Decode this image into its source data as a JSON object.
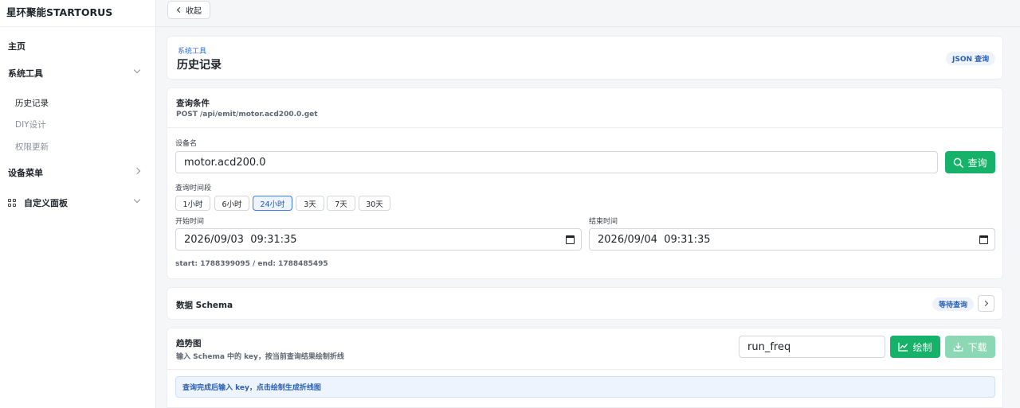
{
  "sidebar": {
    "brand": "星环聚能STARTORUS",
    "home": "主页",
    "system_tools": "系统工具",
    "history": "历史记录",
    "diy": "DIY设计",
    "permission": "权限更新",
    "device_menu": "设备菜单",
    "custom_panel": "自定义面板"
  },
  "topbar": {
    "collapse_label": "收起"
  },
  "header": {
    "breadcrumb": "系统工具",
    "title": "历史记录",
    "json_query": "JSON 查询"
  },
  "query": {
    "title": "查询条件",
    "endpoint": "POST /api/emit/motor.acd200.0.get",
    "device_label": "设备名",
    "device_value": "motor.acd200.0",
    "query_button": "查询",
    "range_label": "查询时间段",
    "ranges": [
      "1小时",
      "6小时",
      "24小时",
      "3天",
      "7天",
      "30天"
    ],
    "selected_range": "24小时",
    "start_label": "开始时间",
    "start_value": "2026/09/03  09:31:35",
    "end_label": "结束时间",
    "end_value": "2026/09/04  09:31:35",
    "epoch_summary": "start: 1788399095 / end: 1788485495"
  },
  "schema": {
    "title": "数据 Schema",
    "status": "等待查询"
  },
  "trend": {
    "title": "趋势图",
    "subtitle": "输入 Schema 中的 key，按当前查询结果绘制折线",
    "key_value": "run_freq",
    "draw_button": "绘制",
    "download_button": "下载",
    "hint": "查询完成后输入 key，点击绘制生成折线图"
  },
  "colors": {
    "accent_green": "#17b26a",
    "accent_blue": "#3b7bf6"
  }
}
